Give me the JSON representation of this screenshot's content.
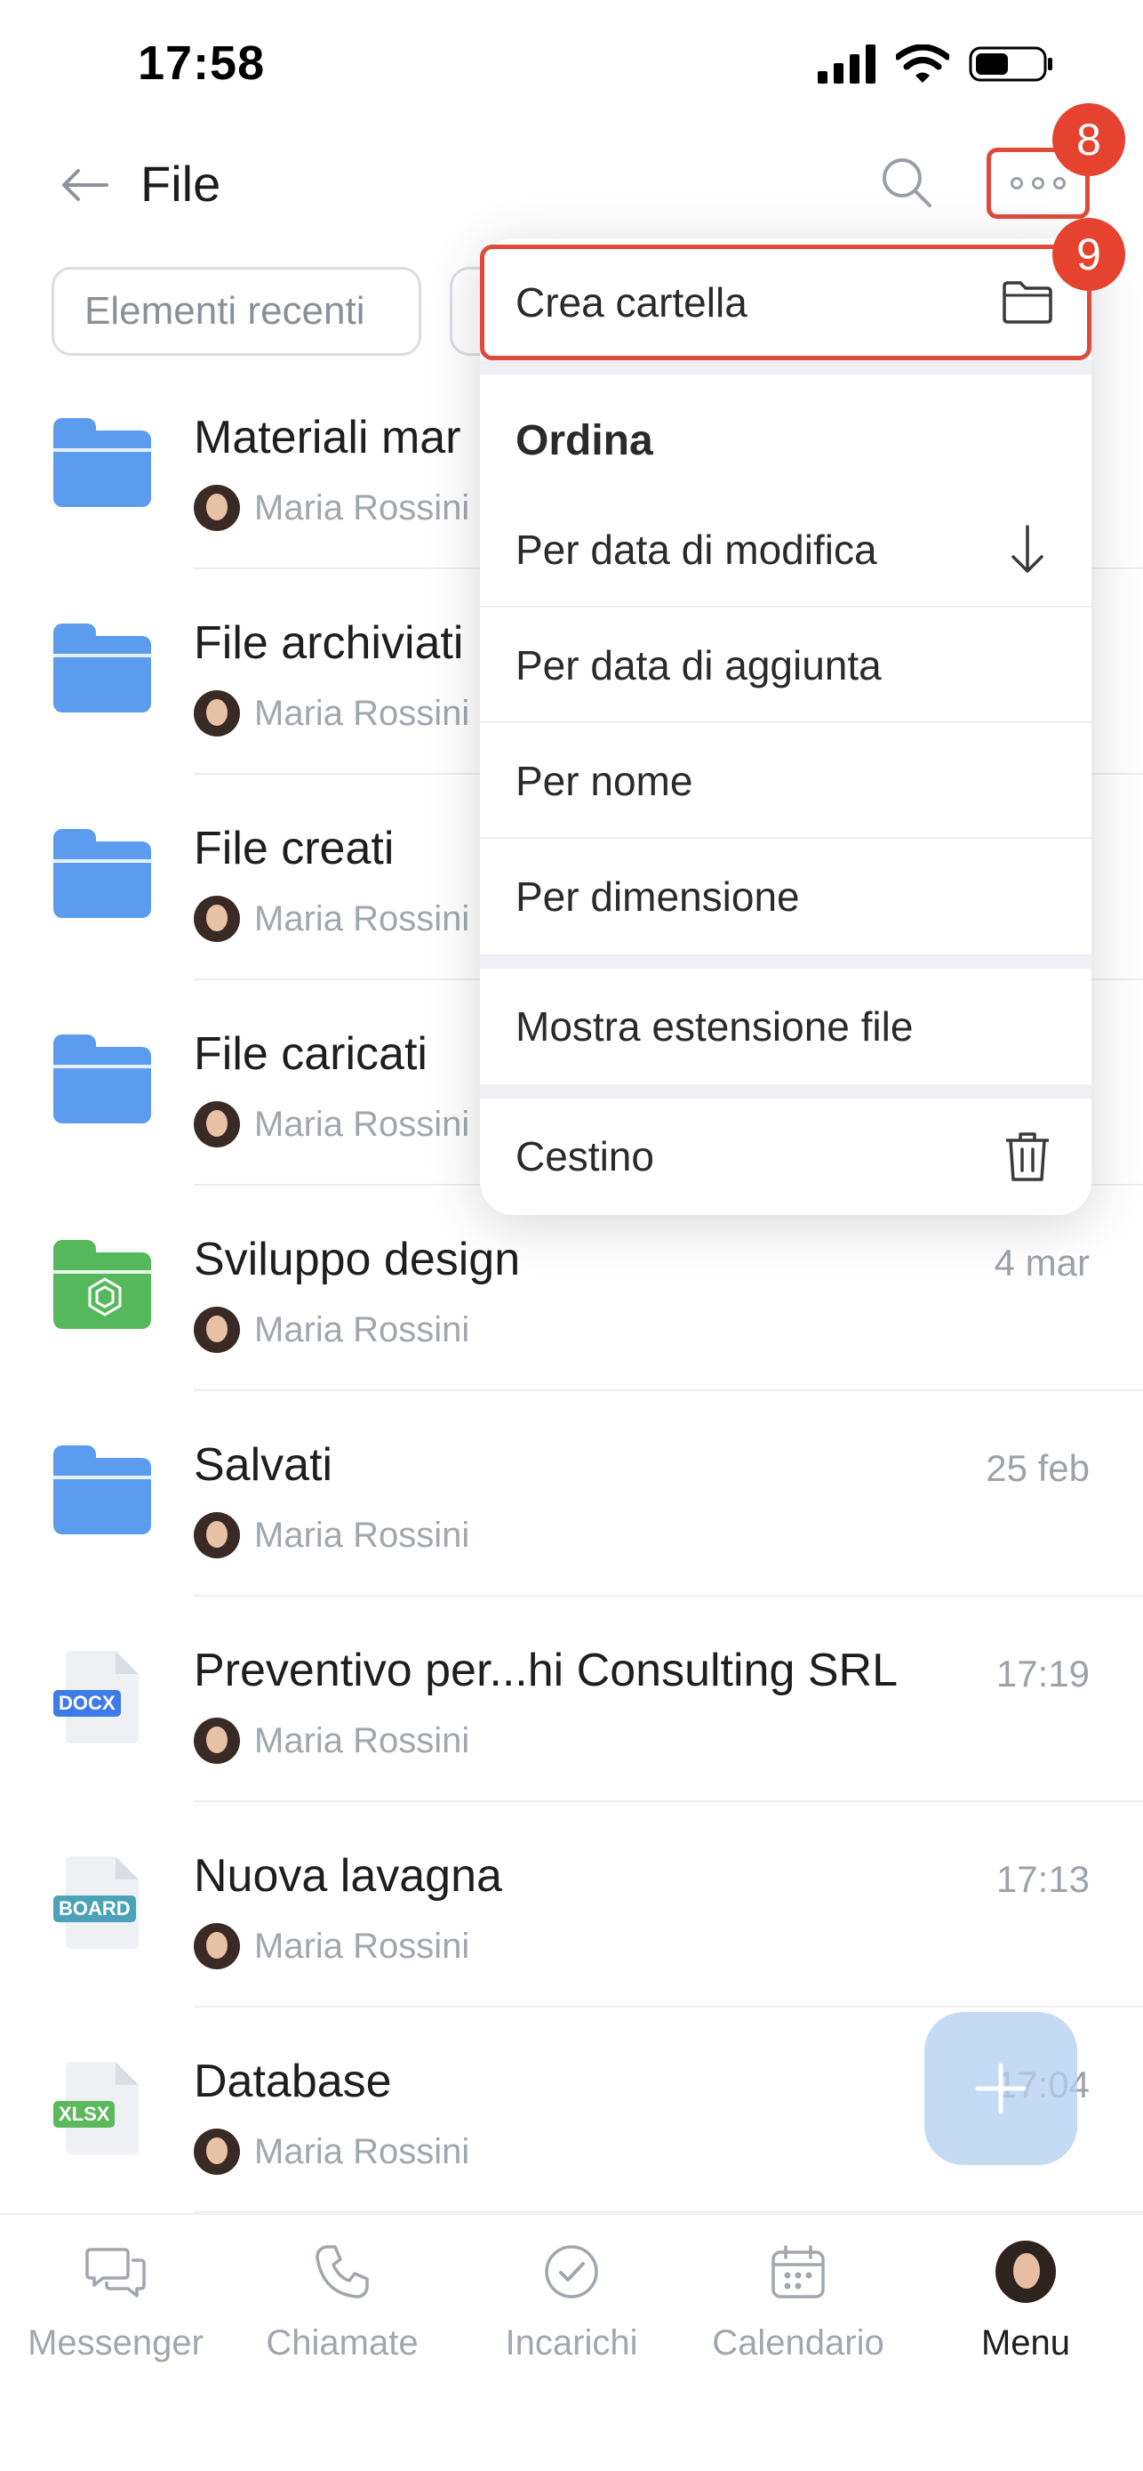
{
  "status_bar": {
    "time": "17:58"
  },
  "header": {
    "title": "File"
  },
  "annotations": {
    "step_more": "8",
    "step_create": "9"
  },
  "filters": {
    "recent": "Elementi recenti"
  },
  "files": [
    {
      "name": "Materiali mar",
      "owner": "Maria Rossini",
      "date": "",
      "icon": "folder-icon",
      "color": "#5b9cef"
    },
    {
      "name": "File archiviati",
      "owner": "Maria Rossini",
      "date": "",
      "icon": "folder-icon",
      "color": "#5b9cef"
    },
    {
      "name": "File creati",
      "owner": "Maria Rossini",
      "date": "",
      "icon": "folder-icon",
      "color": "#5b9cef"
    },
    {
      "name": "File caricati",
      "owner": "Maria Rossini",
      "date": "",
      "icon": "folder-icon",
      "color": "#5b9cef"
    },
    {
      "name": "Sviluppo design",
      "owner": "Maria Rossini",
      "date": "4 mar",
      "icon": "shared-folder-icon",
      "color": "#55b85a"
    },
    {
      "name": "Salvati",
      "owner": "Maria Rossini",
      "date": "25 feb",
      "icon": "folder-icon",
      "color": "#5b9cef"
    },
    {
      "name": "Preventivo per...hi Consulting SRL",
      "owner": "Maria Rossini",
      "date": "17:19",
      "icon": "docx-file-icon",
      "label": "DOCX",
      "color": "#3e7be6"
    },
    {
      "name": "Nuova lavagna",
      "owner": "Maria Rossini",
      "date": "17:13",
      "icon": "board-file-icon",
      "label": "BOARD",
      "color": "#4aa3b8"
    },
    {
      "name": "Database",
      "owner": "Maria Rossini",
      "date": "17:04",
      "icon": "xlsx-file-icon",
      "label": "XLSX",
      "color": "#5cb85c"
    }
  ],
  "menu": {
    "create_folder": "Crea cartella",
    "sort_heading": "Ordina",
    "sort_by_modified": "Per data di modifica",
    "sort_by_added": "Per data di aggiunta",
    "sort_by_name": "Per nome",
    "sort_by_size": "Per dimensione",
    "show_extension": "Mostra estensione file",
    "trash": "Cestino"
  },
  "bottom_nav": [
    {
      "label": "Messenger",
      "icon": "chat-icon"
    },
    {
      "label": "Chiamate",
      "icon": "phone-icon"
    },
    {
      "label": "Incarichi",
      "icon": "check-circle-icon"
    },
    {
      "label": "Calendario",
      "icon": "calendar-icon"
    },
    {
      "label": "Menu",
      "icon": "avatar-icon"
    }
  ]
}
